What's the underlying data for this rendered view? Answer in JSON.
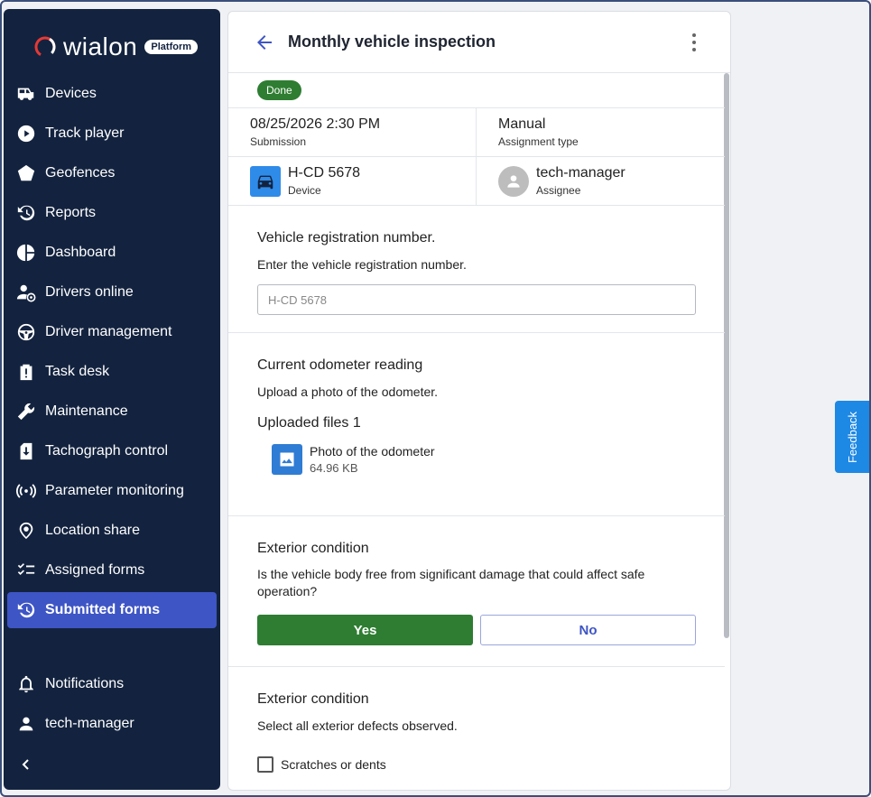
{
  "brand": {
    "name": "wialon",
    "badge": "Platform"
  },
  "sidebar": {
    "items": [
      {
        "label": "Devices",
        "icon": "devices-icon"
      },
      {
        "label": "Track player",
        "icon": "play-icon"
      },
      {
        "label": "Geofences",
        "icon": "pentagon-icon"
      },
      {
        "label": "Reports",
        "icon": "history-icon"
      },
      {
        "label": "Dashboard",
        "icon": "pie-icon"
      },
      {
        "label": "Drivers online",
        "icon": "driver-icon"
      },
      {
        "label": "Driver management",
        "icon": "steering-icon"
      },
      {
        "label": "Task desk",
        "icon": "clipboard-icon"
      },
      {
        "label": "Maintenance",
        "icon": "wrench-icon"
      },
      {
        "label": "Tachograph control",
        "icon": "tachograph-icon"
      },
      {
        "label": "Parameter monitoring",
        "icon": "signal-icon"
      },
      {
        "label": "Location share",
        "icon": "location-icon"
      },
      {
        "label": "Assigned forms",
        "icon": "checklist-icon"
      },
      {
        "label": "Submitted forms",
        "icon": "history-icon",
        "active": true
      }
    ],
    "bottom": [
      {
        "label": "Notifications",
        "icon": "bell-icon"
      },
      {
        "label": "tech-manager",
        "icon": "user-icon"
      }
    ]
  },
  "form": {
    "title": "Monthly vehicle inspection",
    "status": "Done",
    "submission_value": "08/25/2026 2:30 PM",
    "submission_label": "Submission",
    "assignment_value": "Manual",
    "assignment_label": "Assignment type",
    "device_value": "H-CD 5678",
    "device_label": "Device",
    "assignee_value": "tech-manager",
    "assignee_label": "Assignee"
  },
  "q1": {
    "title": "Vehicle registration number.",
    "desc": "Enter the vehicle registration number.",
    "value": "H-CD 5678"
  },
  "q2": {
    "title": "Current odometer reading",
    "desc": "Upload a photo of the odometer.",
    "files_title": "Uploaded files 1",
    "file_name": "Photo of the odometer",
    "file_size": "64.96 KB"
  },
  "q3": {
    "title": "Exterior condition",
    "desc": "Is the vehicle body free from significant damage that could affect safe operation?",
    "yes": "Yes",
    "no": "No"
  },
  "q4": {
    "title": "Exterior condition",
    "desc": "Select all exterior defects observed.",
    "option1": "Scratches or dents"
  },
  "feedback": "Feedback",
  "colors": {
    "sidebar": "#13233f",
    "active": "#3e55c5",
    "success": "#2e7d32",
    "accent": "#1e88e5"
  }
}
